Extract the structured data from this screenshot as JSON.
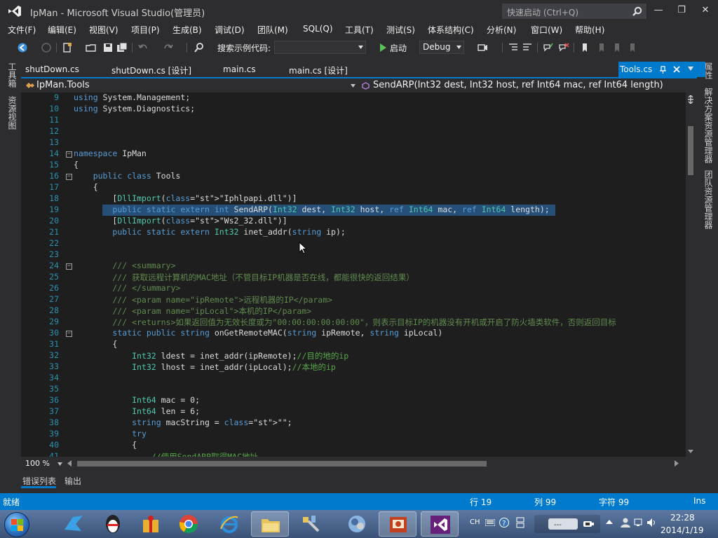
{
  "window": {
    "title": "IpMan - Microsoft Visual Studio(管理员)",
    "quick_launch_placeholder": "快速启动 (Ctrl+Q)",
    "minimize": "—",
    "restore": "❐",
    "close": "✕"
  },
  "menu": [
    "文件(F)",
    "编辑(E)",
    "视图(V)",
    "项目(P)",
    "生成(B)",
    "调试(D)",
    "团队(M)",
    "SQL(Q)",
    "工具(T)",
    "测试(S)",
    "体系结构(C)",
    "分析(N)",
    "窗口(W)",
    "帮助(H)"
  ],
  "toolbar": {
    "search_label": "搜索示例代码:",
    "start_label": "启动",
    "configuration": "Debug"
  },
  "left_tabs": [
    "工具箱",
    "资源视图"
  ],
  "right_tabs": [
    "属性",
    "解决方案资源管理器",
    "团队资源管理器"
  ],
  "doc_tabs": [
    {
      "label": "shutDown.cs"
    },
    {
      "label": "shutDown.cs [设计]"
    },
    {
      "label": "main.cs"
    },
    {
      "label": "main.cs [设计]"
    },
    {
      "label": "Tools.cs"
    }
  ],
  "nav": {
    "class_scope": "IpMan.Tools",
    "member_scope": "SendARP(Int32 dest, Int32 host, ref Int64 mac, ref Int64 length)"
  },
  "code_lines": [
    {
      "n": "9",
      "t": "using System.Management;"
    },
    {
      "n": "10",
      "t": "using System.Diagnostics;"
    },
    {
      "n": "11",
      "t": ""
    },
    {
      "n": "12",
      "t": ""
    },
    {
      "n": "13",
      "t": ""
    },
    {
      "n": "14",
      "t": "namespace IpMan"
    },
    {
      "n": "15",
      "t": "{"
    },
    {
      "n": "16",
      "t": "    public class Tools"
    },
    {
      "n": "17",
      "t": "    {"
    },
    {
      "n": "18",
      "t": "        [DllImport(\"Iphlpapi.dll\")]"
    },
    {
      "n": "19",
      "t": "        public static extern int SendARP(Int32 dest, Int32 host, ref Int64 mac, ref Int64 length);"
    },
    {
      "n": "20",
      "t": "        [DllImport(\"Ws2_32.dll\")]"
    },
    {
      "n": "21",
      "t": "        public static extern Int32 inet_addr(string ip);"
    },
    {
      "n": "22",
      "t": ""
    },
    {
      "n": "23",
      "t": ""
    },
    {
      "n": "24",
      "t": "        /// <summary>"
    },
    {
      "n": "25",
      "t": "        /// 获取远程计算机的MAC地址（不管目标IP机器是否在线，都能很快的返回结果）"
    },
    {
      "n": "26",
      "t": "        /// </summary>"
    },
    {
      "n": "27",
      "t": "        /// <param name=\"ipRemote\">远程机器的IP</param>"
    },
    {
      "n": "28",
      "t": "        /// <param name=\"ipLocal\">本机的IP</param>"
    },
    {
      "n": "29",
      "t": "        /// <returns>如果返回值为无效长度或为\"00:00:00:00:00:00\"，则表示目标IP的机器没有开机或开启了防火墙类软件，否则返回目标"
    },
    {
      "n": "30",
      "t": "        static public string onGetRemoteMAC(string ipRemote, string ipLocal)"
    },
    {
      "n": "31",
      "t": "        {"
    },
    {
      "n": "32",
      "t": "            Int32 ldest = inet_addr(ipRemote);//目的地的ip"
    },
    {
      "n": "33",
      "t": "            Int32 lhost = inet_addr(ipLocal);//本地的ip"
    },
    {
      "n": "34",
      "t": ""
    },
    {
      "n": "35",
      "t": ""
    },
    {
      "n": "36",
      "t": "            Int64 mac = 0;"
    },
    {
      "n": "37",
      "t": "            Int64 len = 6;"
    },
    {
      "n": "38",
      "t": "            string macString = \"\";"
    },
    {
      "n": "39",
      "t": "            try"
    },
    {
      "n": "40",
      "t": "            {"
    },
    {
      "n": "41",
      "t": "                //使用SendARP取得MAC地址"
    }
  ],
  "editor_bottom": {
    "zoom": "100 %"
  },
  "output_tabs": [
    "错误列表",
    "输出"
  ],
  "status": {
    "ready": "就绪",
    "line": "行 19",
    "col": "列 99",
    "char": "字符 99",
    "mode": "Ins"
  },
  "taskbar": {
    "lang": "CH",
    "time": "22:28",
    "date": "2014/1/19"
  },
  "colors": {
    "accent": "#007acc",
    "editor_bg": "#1e1e1e",
    "chrome_bg": "#2d2d30",
    "selection": "#264f78"
  }
}
